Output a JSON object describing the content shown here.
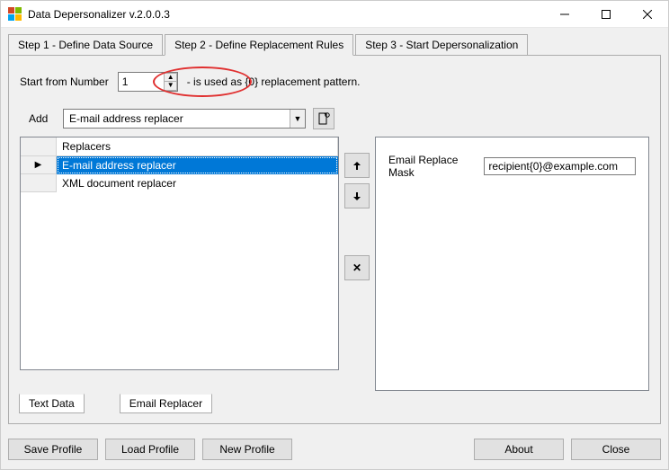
{
  "window": {
    "title": "Data Depersonalizer v.2.0.0.3"
  },
  "tabs": [
    {
      "label": "Step 1 - Define Data Source"
    },
    {
      "label": "Step 2 - Define Replacement Rules"
    },
    {
      "label": "Step 3 - Start Depersonalization"
    }
  ],
  "startFrom": {
    "label": "Start from Number",
    "value": "1",
    "hint": "- is used as {0} replacement pattern."
  },
  "addRow": {
    "label": "Add",
    "selected": "E-mail address replacer"
  },
  "grid": {
    "header": "Replacers",
    "rows": [
      {
        "label": "E-mail address replacer",
        "selected": true
      },
      {
        "label": "XML document replacer",
        "selected": false
      }
    ]
  },
  "rightPanel": {
    "fieldLabel": "Email Replace Mask",
    "fieldValue": "recipient{0}@example.com"
  },
  "subTabs": {
    "left": "Text Data",
    "right": "Email Replacer"
  },
  "footer": {
    "saveProfile": "Save Profile",
    "loadProfile": "Load Profile",
    "newProfile": "New Profile",
    "about": "About",
    "close": "Close"
  }
}
